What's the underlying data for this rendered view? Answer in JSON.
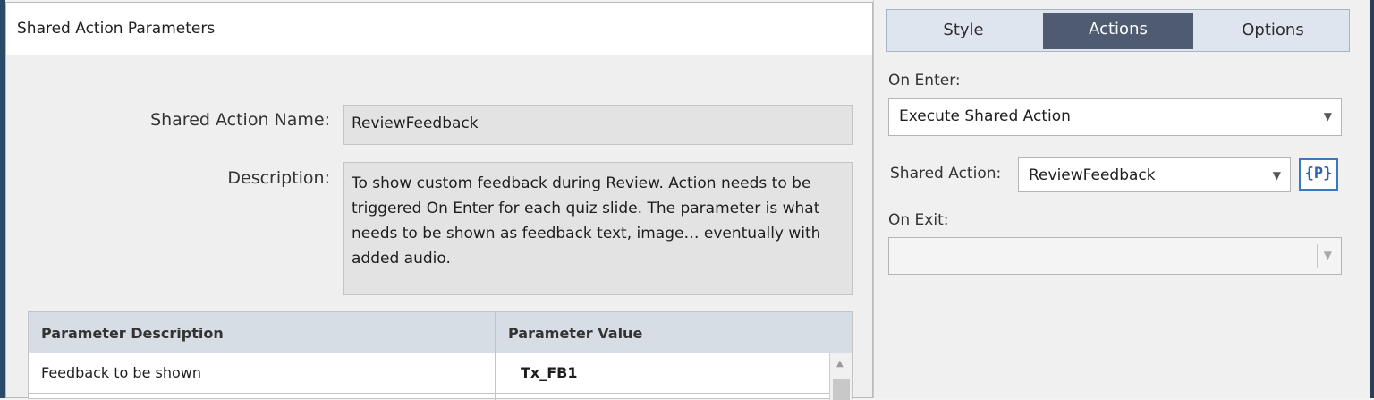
{
  "dialog": {
    "title": "Shared Action Parameters",
    "name_label": "Shared Action Name:",
    "name_value": "ReviewFeedback",
    "description_label": "Description:",
    "description_value": "To show custom feedback during Review. Action needs to be triggered On Enter for each quiz slide. The parameter is what needs to be shown as feedback text, image… eventually with added audio.",
    "table": {
      "headers": [
        "Parameter Description",
        "Parameter Value"
      ],
      "rows": [
        {
          "description": "Feedback to be shown",
          "value": "Tx_FB1"
        }
      ]
    }
  },
  "panel": {
    "tabs": [
      {
        "label": "Style",
        "active": false
      },
      {
        "label": "Actions",
        "active": true
      },
      {
        "label": "Options",
        "active": false
      }
    ],
    "on_enter_label": "On Enter:",
    "on_enter_value": "Execute Shared Action",
    "shared_action_label": "Shared Action:",
    "shared_action_value": "ReviewFeedback",
    "params_button": "{P}",
    "on_exit_label": "On Exit:",
    "on_exit_value": ""
  },
  "colors": {
    "active_tab": "#4e5b70",
    "header_row": "#d7dde5",
    "params_button_border": "#3b78c2"
  },
  "icons": {
    "dropdown": "chevron-down-icon",
    "scroll_up": "scroll-up-arrow-icon"
  }
}
